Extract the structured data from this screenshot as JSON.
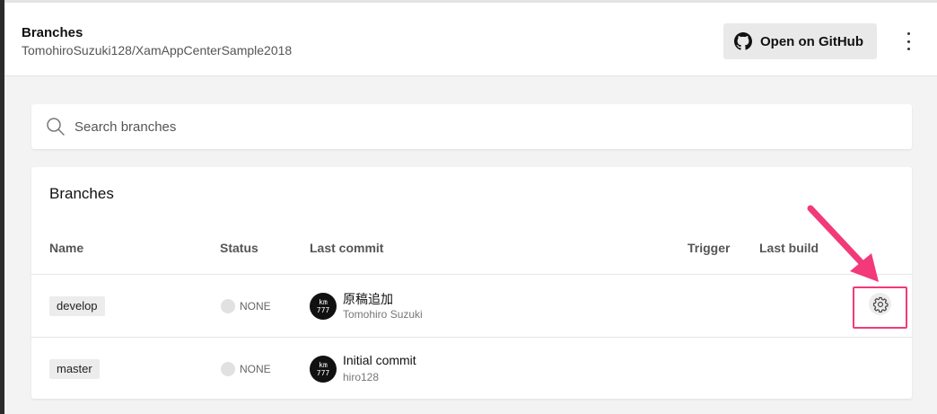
{
  "header": {
    "title": "Branches",
    "subtitle": "TomohiroSuzuki128/XamAppCenterSample2018",
    "github_button_label": "Open on GitHub"
  },
  "search": {
    "placeholder": "Search branches"
  },
  "branches_card": {
    "title": "Branches",
    "columns": [
      "Name",
      "Status",
      "Last commit",
      "Trigger",
      "Last build"
    ],
    "rows": [
      {
        "name": "develop",
        "status": "NONE",
        "commit_message": "原稿追加",
        "author": "Tomohiro Suzuki",
        "avatar_text": [
          "km",
          "777"
        ],
        "has_settings": true
      },
      {
        "name": "master",
        "status": "NONE",
        "commit_message": "Initial commit",
        "author": "hiro128",
        "avatar_text": [
          "km",
          "777"
        ],
        "has_settings": false
      }
    ]
  },
  "annotation": {
    "highlight_color": "#f2397a"
  }
}
